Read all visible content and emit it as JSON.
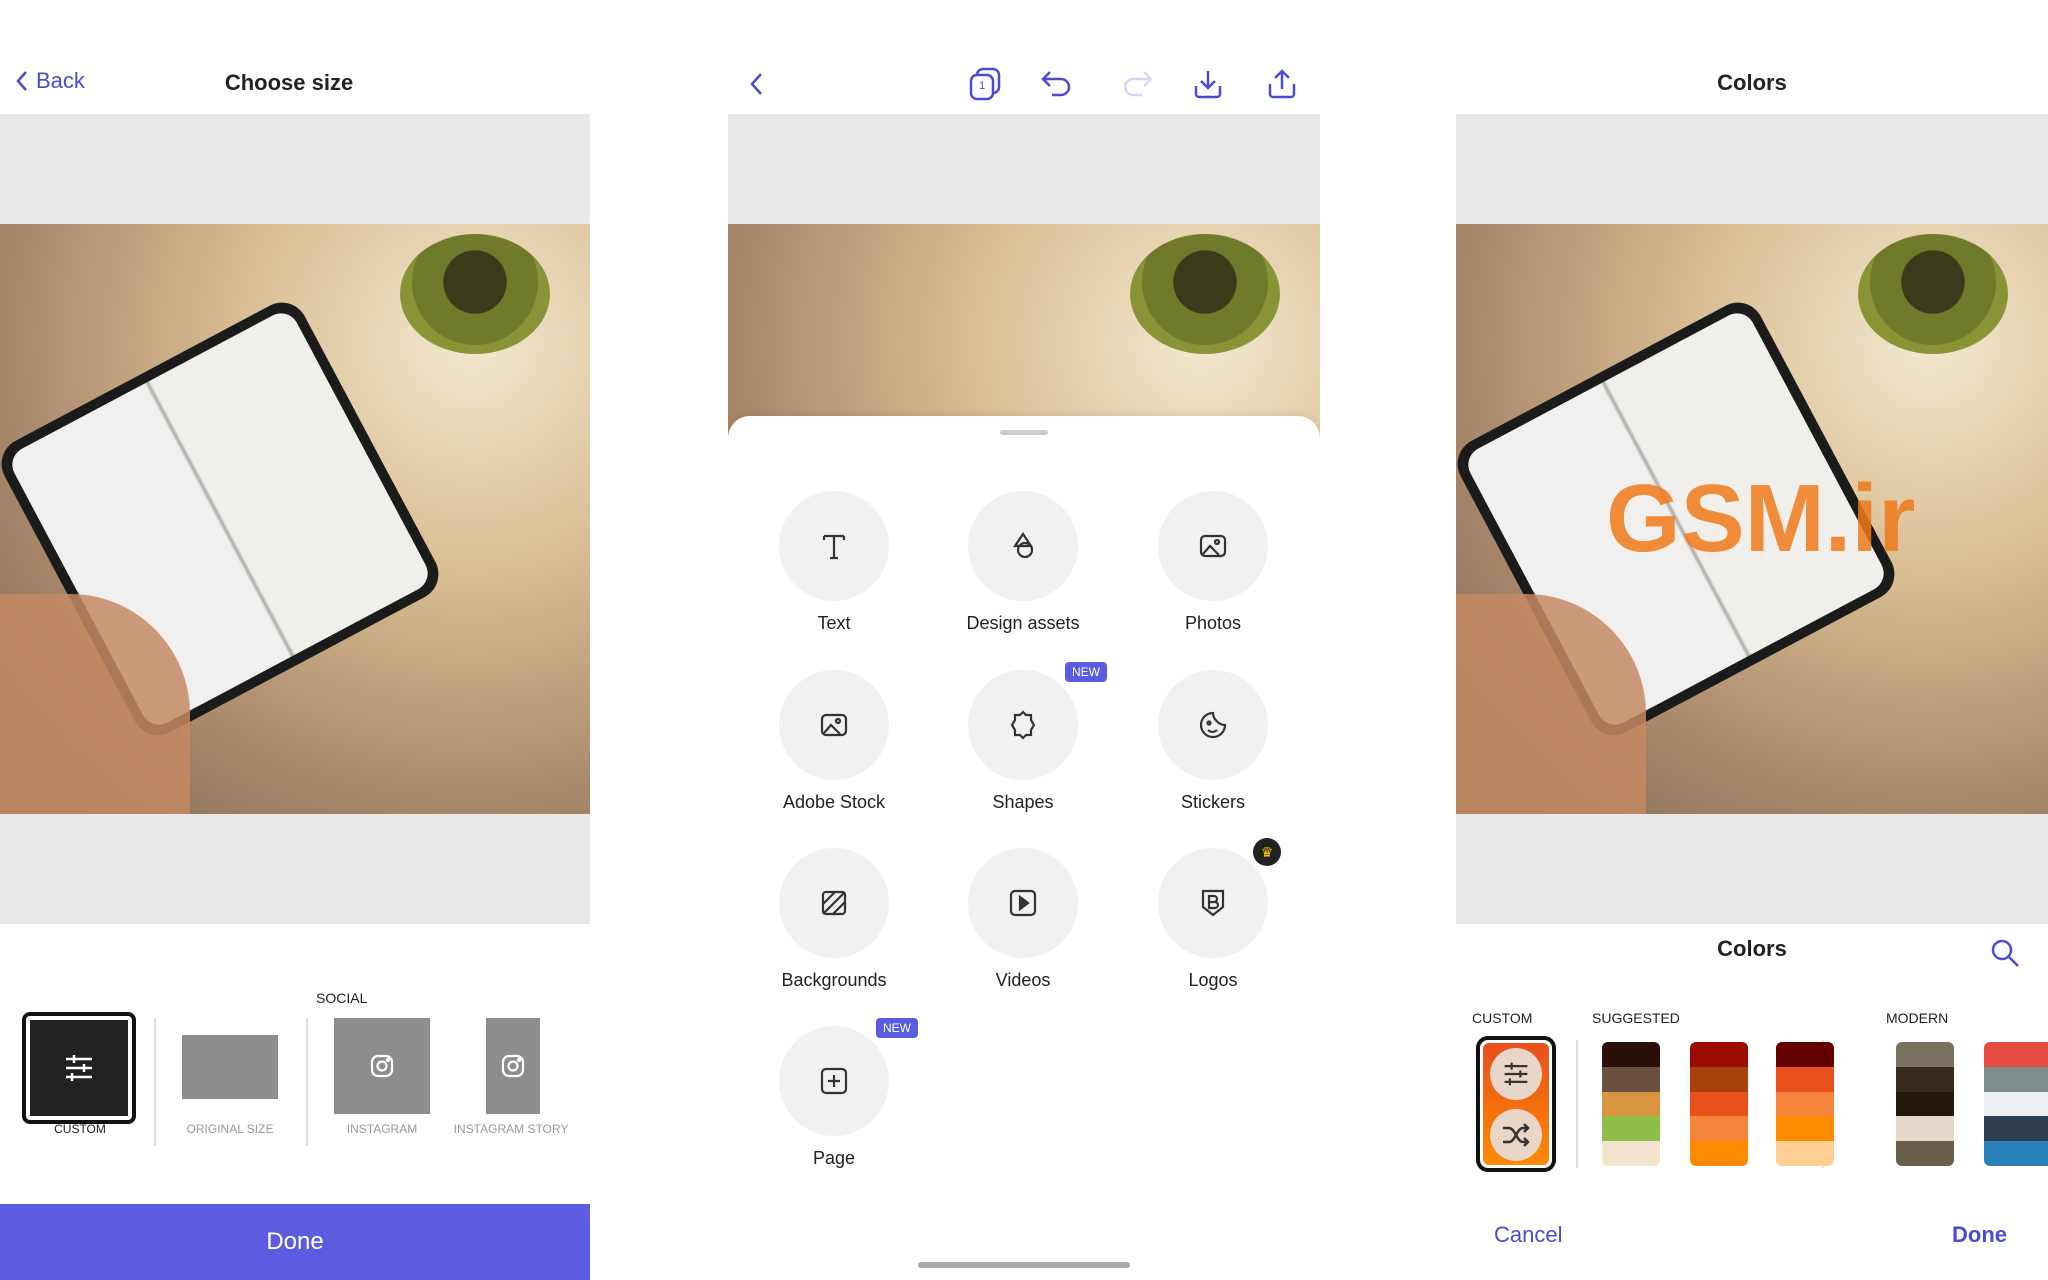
{
  "choose_size": {
    "back_label": "Back",
    "title": "Choose size",
    "section_label": "SOCIAL",
    "options": [
      {
        "label": "CUSTOM",
        "selected": true
      },
      {
        "label": "ORIGINAL SIZE"
      },
      {
        "label": "INSTAGRAM"
      },
      {
        "label": "INSTAGRAM STORY"
      }
    ],
    "done_label": "Done",
    "accent": "#5c5ce0"
  },
  "editor": {
    "toolbar": {
      "back": "chevron-left-icon",
      "pages_count": "1",
      "undo": "undo-icon",
      "redo": "redo-icon",
      "download": "download-icon",
      "share": "share-icon"
    },
    "items": [
      {
        "label": "Text",
        "icon": "text-icon"
      },
      {
        "label": "Design assets",
        "icon": "shapes-icon"
      },
      {
        "label": "Photos",
        "icon": "image-icon"
      },
      {
        "label": "Adobe Stock",
        "icon": "image-icon"
      },
      {
        "label": "Shapes",
        "icon": "badge-icon",
        "badge": "NEW"
      },
      {
        "label": "Stickers",
        "icon": "sticker-icon"
      },
      {
        "label": "Backgrounds",
        "icon": "pattern-icon"
      },
      {
        "label": "Videos",
        "icon": "play-icon"
      },
      {
        "label": "Logos",
        "icon": "logo-icon",
        "premium": true
      },
      {
        "label": "Page",
        "icon": "add-page-icon",
        "badge": "NEW"
      }
    ]
  },
  "colors": {
    "title": "Colors",
    "sheet_title": "Colors",
    "watermark": "GSM.ir",
    "custom_label": "CUSTOM",
    "suggested_label": "SUGGESTED",
    "modern_label": "MODERN",
    "suggested": [
      [
        "#2a0f08",
        "#6b5040",
        "#d9943f",
        "#8fbf4a",
        "#f1e3cc"
      ],
      [
        "#9c0a00",
        "#a8400a",
        "#e8501c",
        "#f4843a",
        "#ff8a00"
      ],
      [
        "#650000",
        "#e8501c",
        "#f4843a",
        "#ff8a00",
        "#ffcf94"
      ]
    ],
    "modern": [
      [
        "#7a7060",
        "#3a2a1c",
        "#24180a",
        "#e6d8c8",
        "#6a5e4a"
      ],
      [
        "#e54b3e",
        "#7f8c8d",
        "#ecf0f1",
        "#2c3e50",
        "#2980b9"
      ]
    ],
    "cancel_label": "Cancel",
    "done_label": "Done"
  }
}
